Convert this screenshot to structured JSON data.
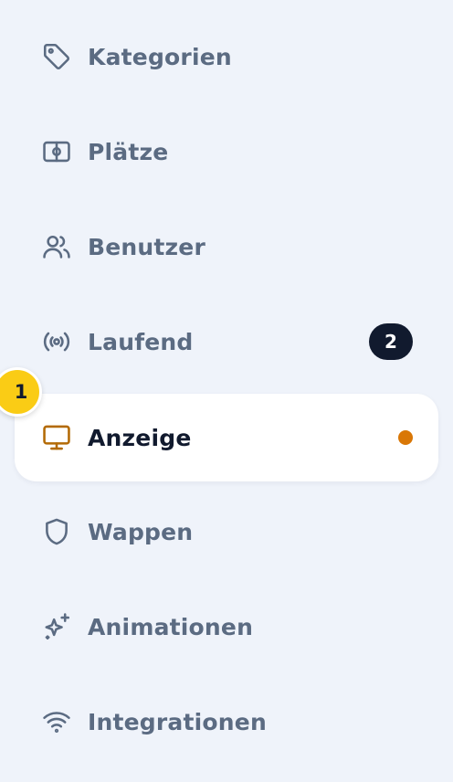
{
  "nav": {
    "items": [
      {
        "label": "Kategorien",
        "icon": "tag-icon"
      },
      {
        "label": "Plätze",
        "icon": "pitch-icon"
      },
      {
        "label": "Benutzer",
        "icon": "users-icon"
      },
      {
        "label": "Laufend",
        "icon": "broadcast-icon",
        "badge": "2"
      },
      {
        "label": "Anzeige",
        "icon": "monitor-icon",
        "active": true,
        "indicator": "dot"
      },
      {
        "label": "Wappen",
        "icon": "shield-icon"
      },
      {
        "label": "Animationen",
        "icon": "sparkles-icon"
      },
      {
        "label": "Integrationen",
        "icon": "wifi-icon"
      }
    ]
  },
  "step_marker": {
    "label": "1"
  },
  "colors": {
    "background": "#eff3fa",
    "text": "#5b6b82",
    "active_text": "#111a2e",
    "active_icon": "#b36a05",
    "dot": "#d97706",
    "badge_bg": "#111a2e",
    "step_marker": "#facc15"
  }
}
